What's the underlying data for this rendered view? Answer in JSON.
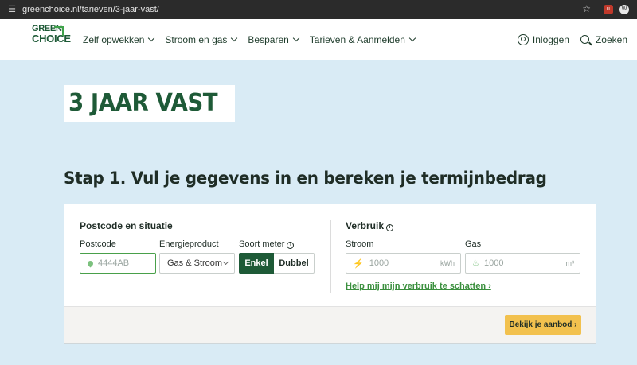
{
  "browser": {
    "url": "greenchoice.nl/tarieven/3-jaar-vast/"
  },
  "header": {
    "logo_top": "GREEN",
    "logo_bottom": "CHOICE",
    "nav": [
      "Zelf opwekken",
      "Stroom en gas",
      "Besparen",
      "Tarieven & Aanmelden"
    ],
    "login_label": "Inloggen",
    "search_label": "Zoeken"
  },
  "hero": {
    "title": "3 JAAR VAST",
    "step_title": "Stap 1. Vul je gegevens in en bereken je termijnbedrag"
  },
  "form": {
    "section_left_title": "Postcode en situatie",
    "postcode_label": "Postcode",
    "postcode_placeholder": "4444AB",
    "product_label": "Energieproduct",
    "product_value": "Gas & Stroom",
    "meter_label": "Soort meter",
    "meter_options": [
      "Enkel",
      "Dubbel"
    ],
    "meter_selected": "Enkel",
    "section_right_title": "Verbruik",
    "stroom_label": "Stroom",
    "stroom_placeholder": "1000",
    "stroom_unit": "kWh",
    "gas_label": "Gas",
    "gas_placeholder": "1000",
    "gas_unit": "m³",
    "help_link": "Help mij mijn verbruik te schatten ›",
    "cta_label": "Bekijk je aanbod ›"
  },
  "colors": {
    "brand_green": "#1e5a37",
    "accent_green": "#49a04a",
    "cta_yellow": "#f2c14e",
    "page_bg": "#d9ebf5"
  }
}
